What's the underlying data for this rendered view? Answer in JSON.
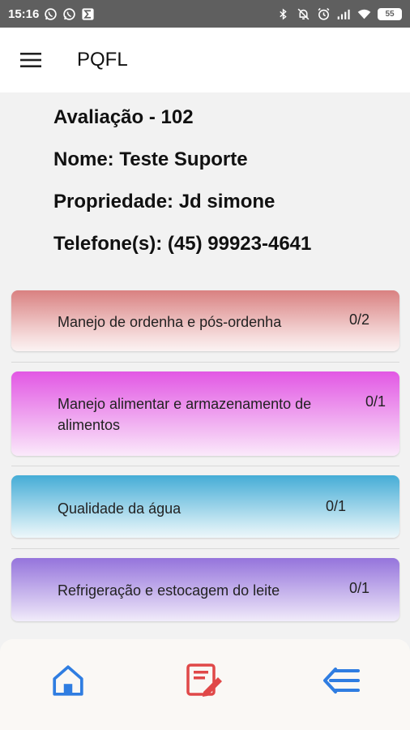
{
  "status_bar": {
    "time": "15:16",
    "battery": "55",
    "left_icons": [
      "whatsapp-icon",
      "whatsapp-icon",
      "sigma-icon"
    ],
    "right_icons": [
      "bluetooth-icon",
      "mute-icon",
      "alarm-icon",
      "signal-icon",
      "wifi-icon",
      "battery-icon"
    ]
  },
  "app_bar": {
    "title": "PQFL",
    "menu_icon": "menu-icon"
  },
  "evaluation": {
    "evaluation_line": "Avaliação - 102",
    "name_line": "Nome: Teste Suporte",
    "property_line": "Propriedade: Jd simone",
    "phone_line": "Telefone(s): (45) 99923-4641"
  },
  "categories": [
    {
      "label": "Manejo de ordenha e pós-ordenha",
      "count": "0/2",
      "color": "#d98181"
    },
    {
      "label": "Manejo alimentar e armazenamento de alimentos",
      "count": "0/1",
      "color": "#e257e4"
    },
    {
      "label": "Qualidade da água",
      "count": "0/1",
      "color": "#45acd6"
    },
    {
      "label": "Refrigeração e estocagem do leite",
      "count": "0/1",
      "color": "#9574dc"
    }
  ],
  "bottom_nav": {
    "home_icon": "home-icon",
    "edit_icon": "edit-document-icon",
    "back_icon": "back-menu-icon",
    "colors": {
      "home": "#2f7de1",
      "edit": "#e04848",
      "back": "#2f7de1"
    }
  }
}
